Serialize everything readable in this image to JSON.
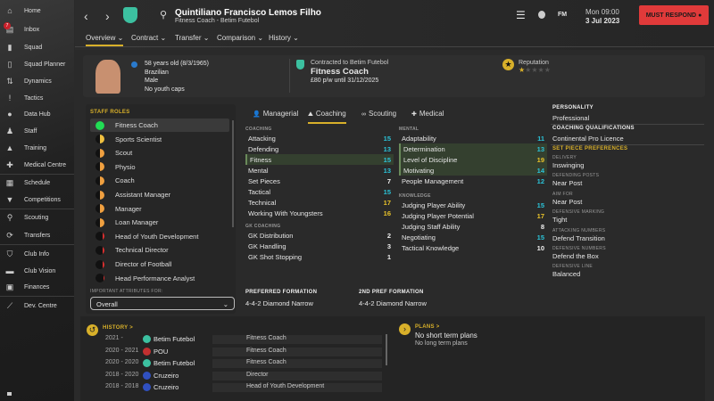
{
  "sidebar": {
    "items": [
      {
        "label": "Home",
        "icon": "home-icon"
      },
      {
        "label": "Inbox",
        "icon": "inbox-icon",
        "badge": "7"
      },
      {
        "label": "Squad",
        "icon": "shirt-icon"
      },
      {
        "label": "Squad Planner",
        "icon": "clipboard-icon"
      },
      {
        "label": "Dynamics",
        "icon": "dynamics-icon"
      },
      {
        "label": "Tactics",
        "icon": "tactics-icon"
      },
      {
        "label": "Data Hub",
        "icon": "data-hub-icon"
      },
      {
        "label": "Staff",
        "icon": "staff-icon"
      },
      {
        "label": "Training",
        "icon": "training-icon"
      },
      {
        "label": "Medical Centre",
        "icon": "medical-icon"
      },
      {
        "label": "Schedule",
        "icon": "calendar-icon"
      },
      {
        "label": "Competitions",
        "icon": "trophy-icon"
      },
      {
        "label": "Scouting",
        "icon": "search-icon"
      },
      {
        "label": "Transfers",
        "icon": "transfers-icon"
      },
      {
        "label": "Club Info",
        "icon": "shield-icon"
      },
      {
        "label": "Club Vision",
        "icon": "briefcase-icon"
      },
      {
        "label": "Finances",
        "icon": "money-icon"
      },
      {
        "label": "Dev. Centre",
        "icon": "dev-centre-icon"
      }
    ]
  },
  "header": {
    "title": "Quintiliano Francisco Lemos Filho",
    "subtitle": "Fitness Coach - Betim Futebol",
    "tabs": [
      "Overview",
      "Contract",
      "Transfer",
      "Comparison",
      "History"
    ],
    "logo": "FM",
    "time": "Mon 09:00",
    "date": "3 Jul 2023",
    "respond": "MUST RESPOND",
    "accent": "#d8b02a",
    "respond_color": "#e03a3a"
  },
  "profile": {
    "age": "58 years old (8/3/1965)",
    "nationality": "Brazilian",
    "gender": "Male",
    "caps": "No youth caps",
    "contract_label": "Contracted to Betim Futebol",
    "role": "Fitness Coach",
    "wage": "£80 p/w until 31/12/2025",
    "reputation_label": "Reputation",
    "reputation_stars": 1,
    "reputation_max": 5
  },
  "staff_roles": {
    "title": "STAFF ROLES",
    "items": [
      {
        "label": "Fitness Coach",
        "fit": 1.0,
        "color": "#22dd55"
      },
      {
        "label": "Sports Scientist",
        "fit": 0.5,
        "color": "#f0c040"
      },
      {
        "label": "Scout",
        "fit": 0.5,
        "color": "#f0a040"
      },
      {
        "label": "Physio",
        "fit": 0.5,
        "color": "#f0a040"
      },
      {
        "label": "Coach",
        "fit": 0.5,
        "color": "#f0a040"
      },
      {
        "label": "Assistant Manager",
        "fit": 0.5,
        "color": "#f0a040"
      },
      {
        "label": "Manager",
        "fit": 0.5,
        "color": "#f0a040"
      },
      {
        "label": "Loan Manager",
        "fit": 0.5,
        "color": "#f0a040"
      },
      {
        "label": "Head of Youth Development",
        "fit": 0.25,
        "color": "#e03030"
      },
      {
        "label": "Technical Director",
        "fit": 0.25,
        "color": "#e03030"
      },
      {
        "label": "Director of Football",
        "fit": 0.25,
        "color": "#e03030"
      },
      {
        "label": "Head Performance Analyst",
        "fit": 0.15,
        "color": "#e03030"
      }
    ],
    "important_label": "IMPORTANT ATTRIBUTES FOR:",
    "important_value": "Overall"
  },
  "attr_tabs": [
    "Managerial",
    "Coaching",
    "Scouting",
    "Medical"
  ],
  "coaching": {
    "title": "COACHING",
    "items": [
      [
        "Attacking",
        15,
        "c",
        0
      ],
      [
        "Defending",
        13,
        "c",
        0
      ],
      [
        "Fitness",
        15,
        "c",
        1
      ],
      [
        "Mental",
        13,
        "c",
        0
      ],
      [
        "Set Pieces",
        7,
        "w",
        0
      ],
      [
        "Tactical",
        15,
        "c",
        0
      ],
      [
        "Technical",
        17,
        "y",
        0
      ],
      [
        "Working With Youngsters",
        16,
        "y",
        0
      ]
    ]
  },
  "gk": {
    "title": "GK COACHING",
    "items": [
      [
        "GK Distribution",
        2,
        "w",
        0
      ],
      [
        "GK Handling",
        3,
        "w",
        0
      ],
      [
        "GK Shot Stopping",
        1,
        "w",
        0
      ]
    ]
  },
  "mental": {
    "title": "MENTAL",
    "items": [
      [
        "Adaptability",
        11,
        "c",
        0
      ],
      [
        "Determination",
        13,
        "c",
        1
      ],
      [
        "Level of Discipline",
        19,
        "y",
        1
      ],
      [
        "Motivating",
        14,
        "c",
        1
      ],
      [
        "People Management",
        12,
        "c",
        0
      ]
    ]
  },
  "knowledge": {
    "title": "KNOWLEDGE",
    "items": [
      [
        "Judging Player Ability",
        15,
        "c",
        0
      ],
      [
        "Judging Player Potential",
        17,
        "y",
        0
      ],
      [
        "Judging Staff Ability",
        8,
        "w",
        0
      ],
      [
        "Negotiating",
        15,
        "c",
        0
      ],
      [
        "Tactical Knowledge",
        10,
        "w",
        0
      ]
    ]
  },
  "formation": {
    "pref_label": "PREFERRED FORMATION",
    "pref": "4-4-2 Diamond Narrow",
    "second_label": "2ND PREF FORMATION",
    "second": "4-4-2 Diamond Narrow"
  },
  "right": {
    "personality_label": "PERSONALITY",
    "personality": "Professional",
    "qual_label": "COACHING QUALIFICATIONS",
    "qual": "Continental Pro Licence",
    "setpiece_label": "SET PIECE PREFERENCES",
    "prefs": [
      [
        "DELIVERY",
        "Inswinging"
      ],
      [
        "DEFENDING POSTS",
        "Near Post"
      ],
      [
        "AIM FOR",
        "Near Post"
      ],
      [
        "DEFENSIVE MARKING",
        "Tight"
      ],
      [
        "ATTACKING NUMBERS",
        "Defend Transition"
      ],
      [
        "DEFENSIVE NUMBERS",
        "Defend the Box"
      ],
      [
        "DEFENSIVE LINE",
        "Balanced"
      ]
    ]
  },
  "history": {
    "title": "HISTORY >",
    "rows": [
      [
        "2021 -",
        "Betim Futebol",
        "Fitness Coach"
      ],
      [
        "2020 - 2021",
        "POU",
        "Fitness Coach"
      ],
      [
        "2020 - 2020",
        "Betim Futebol",
        "Fitness Coach"
      ],
      [
        "2018 - 2020",
        "Cruzeiro",
        "Director"
      ],
      [
        "2018 - 2018",
        "Cruzeiro",
        "Head of Youth Development"
      ]
    ]
  },
  "plans": {
    "title": "PLANS >",
    "short": "No short term plans",
    "long": "No long term plans"
  }
}
